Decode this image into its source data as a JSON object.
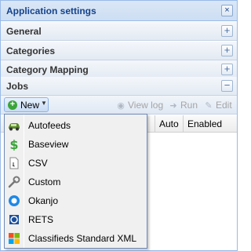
{
  "window": {
    "title": "Application settings"
  },
  "sections": [
    {
      "title": "General",
      "toggle": "+"
    },
    {
      "title": "Categories",
      "toggle": "+"
    },
    {
      "title": "Category Mapping",
      "toggle": "+"
    },
    {
      "title": "Jobs",
      "toggle": "−"
    }
  ],
  "toolbar": {
    "new_label": "New",
    "view_log_label": "View log",
    "run_label": "Run",
    "edit_label": "Edit"
  },
  "grid": {
    "columns": [
      "Auto",
      "Enabled"
    ]
  },
  "menu": {
    "items": [
      {
        "label": "Autofeeds",
        "icon": "car-icon"
      },
      {
        "label": "Baseview",
        "icon": "dollar-icon"
      },
      {
        "label": "CSV",
        "icon": "document-icon"
      },
      {
        "label": "Custom",
        "icon": "wrench-icon"
      },
      {
        "label": "Okanjo",
        "icon": "okanjo-icon"
      },
      {
        "label": "RETS",
        "icon": "rets-icon"
      },
      {
        "label": "Classifieds Standard XML",
        "icon": "windows-icon"
      }
    ]
  },
  "colors": {
    "title_text": "#15428b",
    "border": "#99bbe8",
    "new_icon": "#3aa43a"
  }
}
